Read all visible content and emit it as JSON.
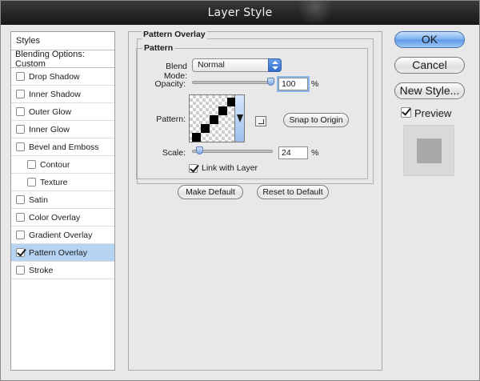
{
  "window": {
    "title": "Layer Style"
  },
  "styles_panel": {
    "header": "Styles",
    "blending_options": "Blending Options: Custom",
    "items": [
      {
        "label": "Drop Shadow",
        "checked": false,
        "indent": false,
        "selected": false
      },
      {
        "label": "Inner Shadow",
        "checked": false,
        "indent": false,
        "selected": false
      },
      {
        "label": "Outer Glow",
        "checked": false,
        "indent": false,
        "selected": false
      },
      {
        "label": "Inner Glow",
        "checked": false,
        "indent": false,
        "selected": false
      },
      {
        "label": "Bevel and Emboss",
        "checked": false,
        "indent": false,
        "selected": false
      },
      {
        "label": "Contour",
        "checked": false,
        "indent": true,
        "selected": false
      },
      {
        "label": "Texture",
        "checked": false,
        "indent": true,
        "selected": false
      },
      {
        "label": "Satin",
        "checked": false,
        "indent": false,
        "selected": false
      },
      {
        "label": "Color Overlay",
        "checked": false,
        "indent": false,
        "selected": false
      },
      {
        "label": "Gradient Overlay",
        "checked": false,
        "indent": false,
        "selected": false
      },
      {
        "label": "Pattern Overlay",
        "checked": true,
        "indent": false,
        "selected": true
      },
      {
        "label": "Stroke",
        "checked": false,
        "indent": false,
        "selected": false
      }
    ]
  },
  "pattern_overlay": {
    "section_title": "Pattern Overlay",
    "subsection_title": "Pattern",
    "blend_mode_label": "Blend Mode:",
    "blend_mode_value": "Normal",
    "opacity_label": "Opacity:",
    "opacity_value": "100",
    "opacity_unit": "%",
    "opacity_fraction": 1.0,
    "pattern_label": "Pattern:",
    "snap_to_origin": "Snap to Origin",
    "scale_label": "Scale:",
    "scale_value": "24",
    "scale_unit": "%",
    "scale_fraction": 0.05,
    "link_with_layer_label": "Link with Layer",
    "link_with_layer_checked": true,
    "make_default": "Make Default",
    "reset_to_default": "Reset to Default"
  },
  "actions": {
    "ok": "OK",
    "cancel": "Cancel",
    "new_style": "New Style...",
    "preview_label": "Preview",
    "preview_checked": true
  },
  "colors": {
    "selection": "#b5d3f3",
    "default_button": "#5c9ae9",
    "titlebar": "#262626"
  }
}
